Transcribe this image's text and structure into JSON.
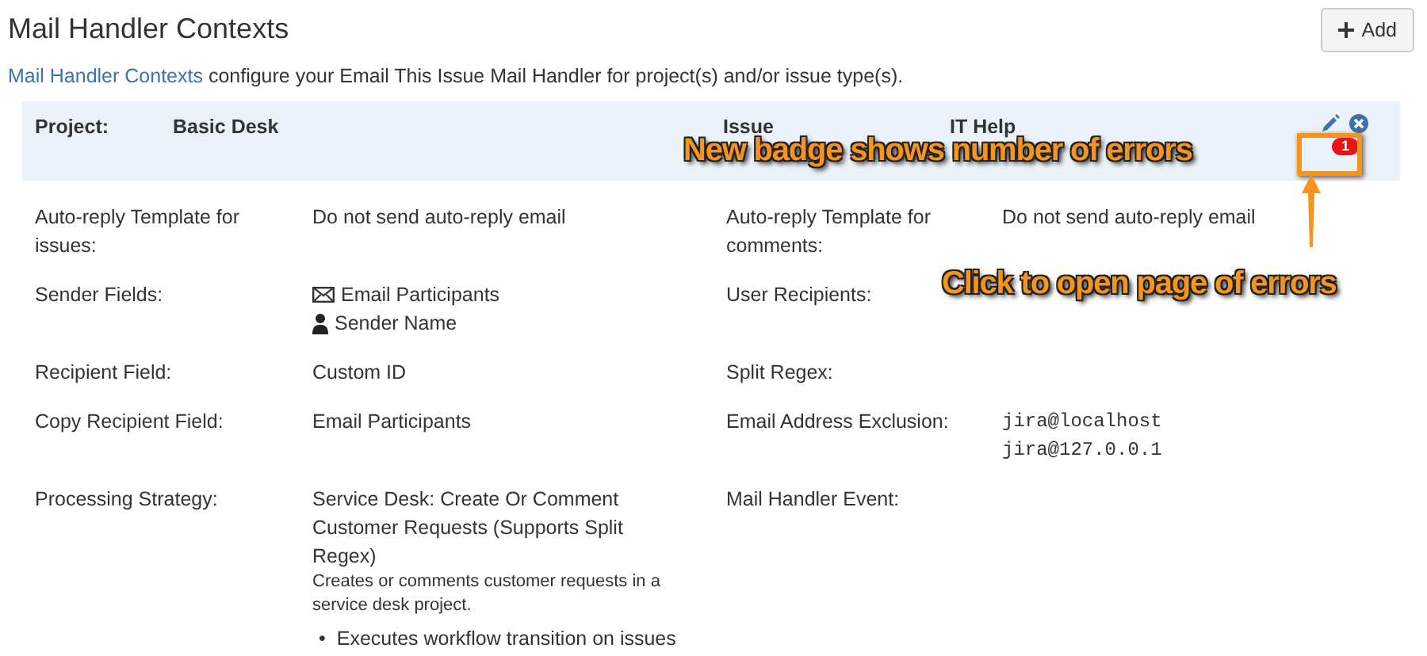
{
  "page": {
    "title": "Mail Handler Contexts",
    "add_button": "Add",
    "description": {
      "link": "Mail Handler Contexts",
      "text": "configure your Email This Issue Mail Handler for project(s) and/or issue type(s)."
    }
  },
  "context": {
    "fields": [
      {
        "label": "Project:",
        "value": "Basic Desk"
      },
      {
        "label": "Issue",
        "value": "IT Help"
      }
    ],
    "error_count": "1"
  },
  "details": [
    {
      "label": "Auto-reply Template for issues:",
      "kind": "text",
      "value": "Do not send auto-reply email"
    },
    {
      "label": "Auto-reply Template for comments:",
      "kind": "text",
      "value": "Do not send auto-reply email"
    },
    {
      "label": "Sender Fields:",
      "kind": "icons",
      "items": [
        {
          "kind": "email",
          "text": "Email Participants"
        },
        {
          "kind": "user",
          "text": "Sender Name"
        }
      ]
    },
    {
      "label": "User Recipients:",
      "kind": "text"
    },
    {
      "label": "Recipient Field:",
      "kind": "text",
      "value": "Custom ID"
    },
    {
      "label": "Split Regex:",
      "kind": "text"
    },
    {
      "label": "Copy Recipient Field:",
      "kind": "text",
      "value": "Email Participants"
    },
    {
      "label": "Email Address Exclusion:",
      "kind": "mono",
      "lines": [
        "jira@localhost",
        "jira@127.0.0.1"
      ]
    },
    {
      "label": "Processing Strategy:",
      "kind": "strategy",
      "value": "Service Desk: Create Or Comment Customer Requests (Supports Split Regex)",
      "note": "Creates or comments customer requests in a service desk project.",
      "bullets": [
        {
          "marker": "•",
          "text": "Executes workflow transition on issues"
        }
      ]
    },
    {
      "label": "Mail Handler Event:",
      "kind": "text"
    }
  ],
  "annotations": [
    {
      "text": "New badge shows number of errors"
    },
    {
      "text": "Click to open page of errors"
    }
  ]
}
